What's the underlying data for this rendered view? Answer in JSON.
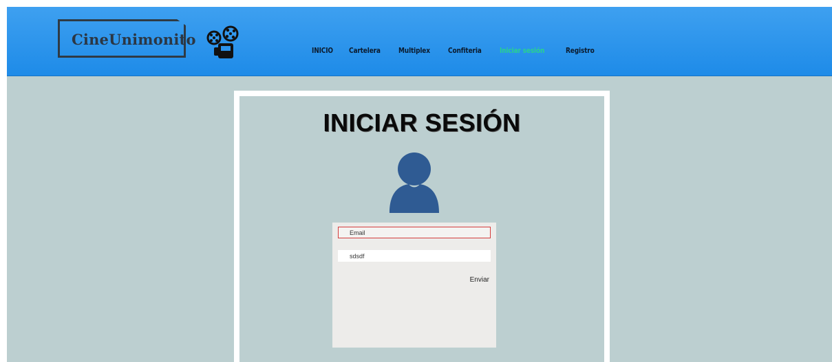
{
  "header": {
    "logo_text": "CineUnimonito",
    "brand_icon": "film-projector-icon",
    "background": "#2b93ec"
  },
  "nav": {
    "items": [
      {
        "label": "INICIO",
        "active": false
      },
      {
        "label": "Cartelera",
        "active": false
      },
      {
        "label": "Multiplex",
        "active": false
      },
      {
        "label": "Confiteria",
        "active": false
      },
      {
        "label": "Iniciar sesión",
        "active": true
      },
      {
        "label": "Registro",
        "active": false
      }
    ],
    "active_color": "#29d28f"
  },
  "login": {
    "title": "INICIAR SESIÓN",
    "avatar_icon": "user-icon",
    "avatar_color": "#2f5b93",
    "email_placeholder": "Email",
    "password_value": "sdsdf",
    "submit_label": "Enviar"
  }
}
